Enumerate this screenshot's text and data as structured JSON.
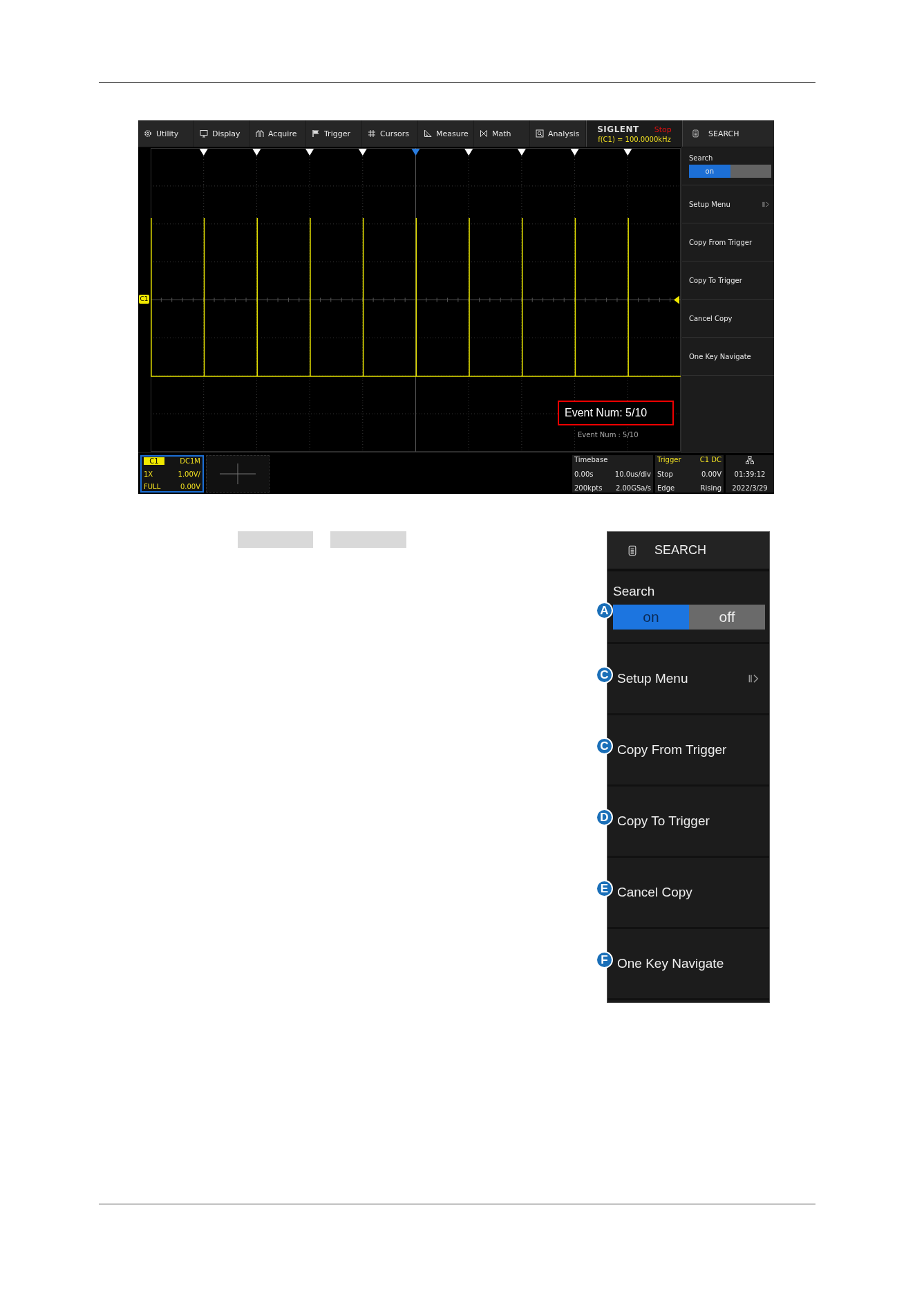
{
  "screen": {
    "toolbar": [
      {
        "kind": "gear",
        "label": "Utility"
      },
      {
        "kind": "monitor",
        "label": "Display"
      },
      {
        "kind": "pulse",
        "label": "Acquire"
      },
      {
        "kind": "flag",
        "label": "Trigger"
      },
      {
        "kind": "hash",
        "label": "Cursors"
      },
      {
        "kind": "ruler",
        "label": "Measure"
      },
      {
        "kind": "bowtie",
        "label": "Math"
      },
      {
        "kind": "magnifier",
        "label": "Analysis"
      }
    ],
    "brand": "SIGLENT",
    "run_state": "Stop",
    "frequency": "f(C1) = 100.0000kHz",
    "menu_title": "SEARCH",
    "channel_marker": "C1",
    "event_markers": [
      {
        "selected": false
      },
      {
        "selected": false
      },
      {
        "selected": false
      },
      {
        "selected": false
      },
      {
        "selected": true
      },
      {
        "selected": false
      },
      {
        "selected": false
      },
      {
        "selected": false
      },
      {
        "selected": false
      }
    ],
    "callout": "Event Num: 5/10",
    "event_label": "Event Num : 5/10",
    "side_menu": {
      "search_label": "Search",
      "toggle": [
        {
          "label": "on",
          "selected": true
        },
        {
          "selected": false
        }
      ],
      "items": [
        {
          "label": "Setup Menu",
          "submenu": true
        },
        {
          "label": "Copy From Trigger",
          "submenu": false
        },
        {
          "label": "Copy To Trigger",
          "submenu": false
        },
        {
          "label": "Cancel Copy",
          "submenu": false
        },
        {
          "label": "One Key Navigate",
          "submenu": false
        }
      ]
    },
    "channel": {
      "name": "C1",
      "coupling": "DC1M",
      "probe": "1X",
      "scale": "1.00V/",
      "bandwidth": "FULL",
      "offset": "0.00V"
    },
    "timebase": {
      "title": "Timebase",
      "delay": "0.00s",
      "scale": "10.0us/div",
      "memory": "200kpts",
      "sample_rate": "2.00GSa/s"
    },
    "trigger": {
      "title": "Trigger",
      "source": "C1 DC",
      "mode": "Stop",
      "level": "0.00V",
      "type": "Edge",
      "slope": "Rising"
    },
    "clock": {
      "time": "01:39:12",
      "date": "2022/3/29"
    }
  },
  "menu_detail": {
    "title": "SEARCH",
    "search_label": "Search",
    "search_badge": "A",
    "toggle": [
      {
        "label": "on",
        "selected": true
      },
      {
        "label": "off",
        "selected": false
      }
    ],
    "items": [
      {
        "label": "Setup Menu",
        "badge": "C",
        "submenu": true
      },
      {
        "label": "Copy From Trigger",
        "badge": "C",
        "submenu": false
      },
      {
        "label": "Copy To Trigger",
        "badge": "D",
        "submenu": false
      },
      {
        "label": "Cancel Copy",
        "badge": "E",
        "submenu": false
      },
      {
        "label": "One Key Navigate",
        "badge": "F",
        "submenu": false
      }
    ]
  }
}
